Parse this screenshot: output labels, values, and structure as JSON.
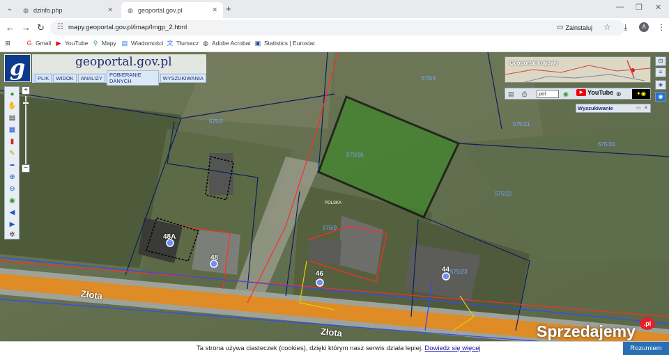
{
  "browser": {
    "tabs": [
      {
        "title": "dzinfo.php",
        "active": false
      },
      {
        "title": "geoportal.gov.pl",
        "active": true
      }
    ],
    "url": "mapy.geoportal.gov.pl/imap/Imgp_2.html",
    "install_label": "Zainstaluj",
    "profile_initial": "A",
    "bookmarks": [
      "Gmail",
      "YouTube",
      "Mapy",
      "Wiadomości",
      "Tłumacz",
      "Adobe Acrobat",
      "Statistics | Eurostat"
    ]
  },
  "app": {
    "brand": "geoportal.gov.pl",
    "menu": [
      "PLIK",
      "WIDOK",
      "ANALIZY",
      "POBIERANIE DANYCH",
      "WYSZUKIWANIA"
    ],
    "overview_title": "Geoportal krajowy",
    "lang_value": "pol",
    "youtube_label": "YouTube",
    "search_panel_title": "Wyszukiwanie"
  },
  "map": {
    "parcels": [
      "575/2",
      "575/16",
      "575/21",
      "575/24",
      "575/22",
      "575/9",
      "575/23",
      "575/4"
    ],
    "addresses": [
      "48A",
      "48",
      "46",
      "44"
    ],
    "streets": [
      "Złota",
      "Złota"
    ],
    "other_labels": [
      "POLSKA"
    ]
  },
  "watermark": {
    "text": "Sprzedajemy",
    "suffix": ".pl"
  },
  "cookie": {
    "message": "Ta strona używa ciasteczek (cookies), dzięki którym nasz serwis działa lepiej.",
    "more": "Dowiedz się więcej",
    "accept": "Rozumiem"
  },
  "colors": {
    "highlight_parcel": "#3e8a2a",
    "road": "#e5891c",
    "brand_blue": "#0d3b8c"
  }
}
